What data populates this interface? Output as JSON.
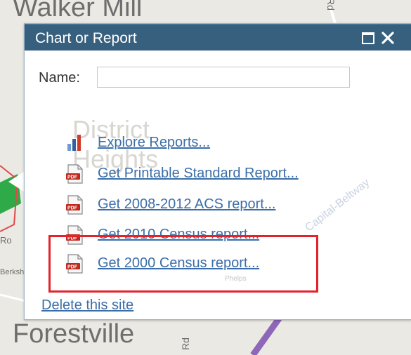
{
  "map": {
    "labels": [
      "Walker Mill",
      "Forestville",
      "Rd",
      "Rd",
      "Ro",
      "Capital-Beltway",
      "Berkshire",
      "Phelps"
    ],
    "colors": {
      "background": "#ebe9e3",
      "beltway": "#8e67b8",
      "road_green": "#2eaa48",
      "road_red": "#e24a4a"
    }
  },
  "popup": {
    "title": "Chart or Report",
    "controls": {
      "maximize_icon": "window-maximize-icon",
      "close_icon": "close-icon"
    },
    "name_label": "Name:",
    "name_value": "",
    "reports": [
      {
        "label": "Explore Reports...",
        "icon": "bar-chart-icon"
      },
      {
        "label": "Get Printable Standard Report...",
        "icon": "pdf-icon"
      },
      {
        "label": "Get 2008-2012 ACS report...",
        "icon": "pdf-icon"
      },
      {
        "label": "Get 2010 Census report...",
        "icon": "pdf-icon"
      },
      {
        "label": "Get 2000 Census report...",
        "icon": "pdf-icon"
      }
    ],
    "delete_link": "Delete this site",
    "colors": {
      "titlebar": "#37607f",
      "link": "#3b6ea8",
      "highlight": "#e2232a"
    }
  }
}
